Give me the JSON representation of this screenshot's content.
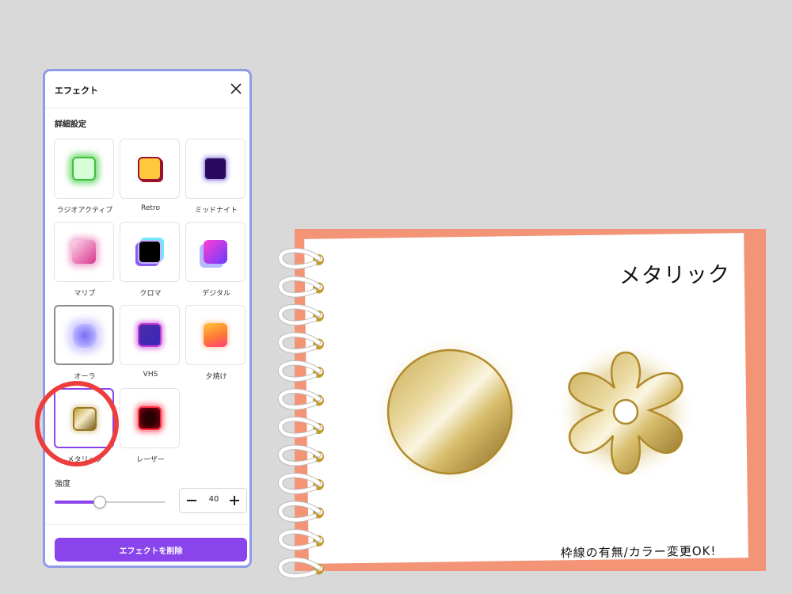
{
  "panel": {
    "title": "エフェクト",
    "section_title": "詳細設定",
    "effects": [
      {
        "label": "ラジオアクティブ",
        "icon": "radioactive-swatch"
      },
      {
        "label": "Retro",
        "icon": "retro-swatch"
      },
      {
        "label": "ミッドナイト",
        "icon": "midnight-swatch"
      },
      {
        "label": "マリブ",
        "icon": "malibu-swatch"
      },
      {
        "label": "クロマ",
        "icon": "chroma-swatch"
      },
      {
        "label": "デジタル",
        "icon": "digital-swatch"
      },
      {
        "label": "オーラ",
        "icon": "aura-swatch"
      },
      {
        "label": "VHS",
        "icon": "vhs-swatch"
      },
      {
        "label": "夕焼け",
        "icon": "sunset-swatch"
      },
      {
        "label": "メタリック",
        "icon": "metallic-swatch"
      },
      {
        "label": "レーザー",
        "icon": "laser-swatch"
      }
    ],
    "strength_label": "強度",
    "strength_value": "40",
    "strength_max": 100,
    "remove_label": "エフェクトを削除",
    "accent_color": "#8a44ec",
    "border_color": "#8e9be8"
  },
  "notebook": {
    "title": "メタリック",
    "note": "枠線の有無/カラー変更OK!",
    "back_color": "#f39477",
    "metal_color": "#b08a2a"
  },
  "highlight_color": "#ee3d3d"
}
